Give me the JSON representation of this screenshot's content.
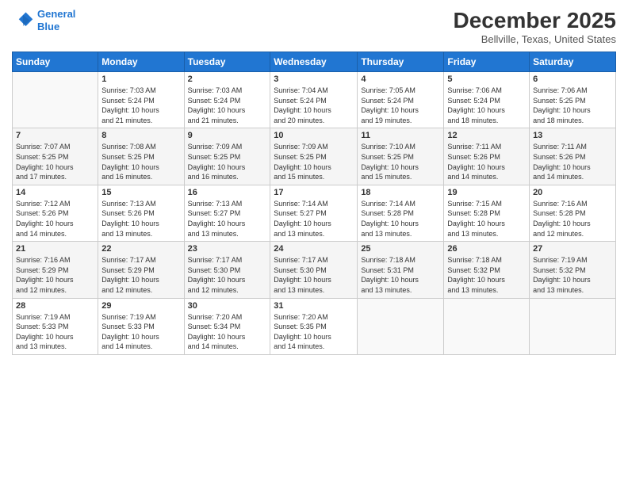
{
  "header": {
    "logo_line1": "General",
    "logo_line2": "Blue",
    "month": "December 2025",
    "location": "Bellville, Texas, United States"
  },
  "weekdays": [
    "Sunday",
    "Monday",
    "Tuesday",
    "Wednesday",
    "Thursday",
    "Friday",
    "Saturday"
  ],
  "weeks": [
    [
      {
        "day": "",
        "info": ""
      },
      {
        "day": "1",
        "info": "Sunrise: 7:03 AM\nSunset: 5:24 PM\nDaylight: 10 hours\nand 21 minutes."
      },
      {
        "day": "2",
        "info": "Sunrise: 7:03 AM\nSunset: 5:24 PM\nDaylight: 10 hours\nand 21 minutes."
      },
      {
        "day": "3",
        "info": "Sunrise: 7:04 AM\nSunset: 5:24 PM\nDaylight: 10 hours\nand 20 minutes."
      },
      {
        "day": "4",
        "info": "Sunrise: 7:05 AM\nSunset: 5:24 PM\nDaylight: 10 hours\nand 19 minutes."
      },
      {
        "day": "5",
        "info": "Sunrise: 7:06 AM\nSunset: 5:24 PM\nDaylight: 10 hours\nand 18 minutes."
      },
      {
        "day": "6",
        "info": "Sunrise: 7:06 AM\nSunset: 5:25 PM\nDaylight: 10 hours\nand 18 minutes."
      }
    ],
    [
      {
        "day": "7",
        "info": "Sunrise: 7:07 AM\nSunset: 5:25 PM\nDaylight: 10 hours\nand 17 minutes."
      },
      {
        "day": "8",
        "info": "Sunrise: 7:08 AM\nSunset: 5:25 PM\nDaylight: 10 hours\nand 16 minutes."
      },
      {
        "day": "9",
        "info": "Sunrise: 7:09 AM\nSunset: 5:25 PM\nDaylight: 10 hours\nand 16 minutes."
      },
      {
        "day": "10",
        "info": "Sunrise: 7:09 AM\nSunset: 5:25 PM\nDaylight: 10 hours\nand 15 minutes."
      },
      {
        "day": "11",
        "info": "Sunrise: 7:10 AM\nSunset: 5:25 PM\nDaylight: 10 hours\nand 15 minutes."
      },
      {
        "day": "12",
        "info": "Sunrise: 7:11 AM\nSunset: 5:26 PM\nDaylight: 10 hours\nand 14 minutes."
      },
      {
        "day": "13",
        "info": "Sunrise: 7:11 AM\nSunset: 5:26 PM\nDaylight: 10 hours\nand 14 minutes."
      }
    ],
    [
      {
        "day": "14",
        "info": "Sunrise: 7:12 AM\nSunset: 5:26 PM\nDaylight: 10 hours\nand 14 minutes."
      },
      {
        "day": "15",
        "info": "Sunrise: 7:13 AM\nSunset: 5:26 PM\nDaylight: 10 hours\nand 13 minutes."
      },
      {
        "day": "16",
        "info": "Sunrise: 7:13 AM\nSunset: 5:27 PM\nDaylight: 10 hours\nand 13 minutes."
      },
      {
        "day": "17",
        "info": "Sunrise: 7:14 AM\nSunset: 5:27 PM\nDaylight: 10 hours\nand 13 minutes."
      },
      {
        "day": "18",
        "info": "Sunrise: 7:14 AM\nSunset: 5:28 PM\nDaylight: 10 hours\nand 13 minutes."
      },
      {
        "day": "19",
        "info": "Sunrise: 7:15 AM\nSunset: 5:28 PM\nDaylight: 10 hours\nand 13 minutes."
      },
      {
        "day": "20",
        "info": "Sunrise: 7:16 AM\nSunset: 5:28 PM\nDaylight: 10 hours\nand 12 minutes."
      }
    ],
    [
      {
        "day": "21",
        "info": "Sunrise: 7:16 AM\nSunset: 5:29 PM\nDaylight: 10 hours\nand 12 minutes."
      },
      {
        "day": "22",
        "info": "Sunrise: 7:17 AM\nSunset: 5:29 PM\nDaylight: 10 hours\nand 12 minutes."
      },
      {
        "day": "23",
        "info": "Sunrise: 7:17 AM\nSunset: 5:30 PM\nDaylight: 10 hours\nand 12 minutes."
      },
      {
        "day": "24",
        "info": "Sunrise: 7:17 AM\nSunset: 5:30 PM\nDaylight: 10 hours\nand 13 minutes."
      },
      {
        "day": "25",
        "info": "Sunrise: 7:18 AM\nSunset: 5:31 PM\nDaylight: 10 hours\nand 13 minutes."
      },
      {
        "day": "26",
        "info": "Sunrise: 7:18 AM\nSunset: 5:32 PM\nDaylight: 10 hours\nand 13 minutes."
      },
      {
        "day": "27",
        "info": "Sunrise: 7:19 AM\nSunset: 5:32 PM\nDaylight: 10 hours\nand 13 minutes."
      }
    ],
    [
      {
        "day": "28",
        "info": "Sunrise: 7:19 AM\nSunset: 5:33 PM\nDaylight: 10 hours\nand 13 minutes."
      },
      {
        "day": "29",
        "info": "Sunrise: 7:19 AM\nSunset: 5:33 PM\nDaylight: 10 hours\nand 14 minutes."
      },
      {
        "day": "30",
        "info": "Sunrise: 7:20 AM\nSunset: 5:34 PM\nDaylight: 10 hours\nand 14 minutes."
      },
      {
        "day": "31",
        "info": "Sunrise: 7:20 AM\nSunset: 5:35 PM\nDaylight: 10 hours\nand 14 minutes."
      },
      {
        "day": "",
        "info": ""
      },
      {
        "day": "",
        "info": ""
      },
      {
        "day": "",
        "info": ""
      }
    ]
  ]
}
